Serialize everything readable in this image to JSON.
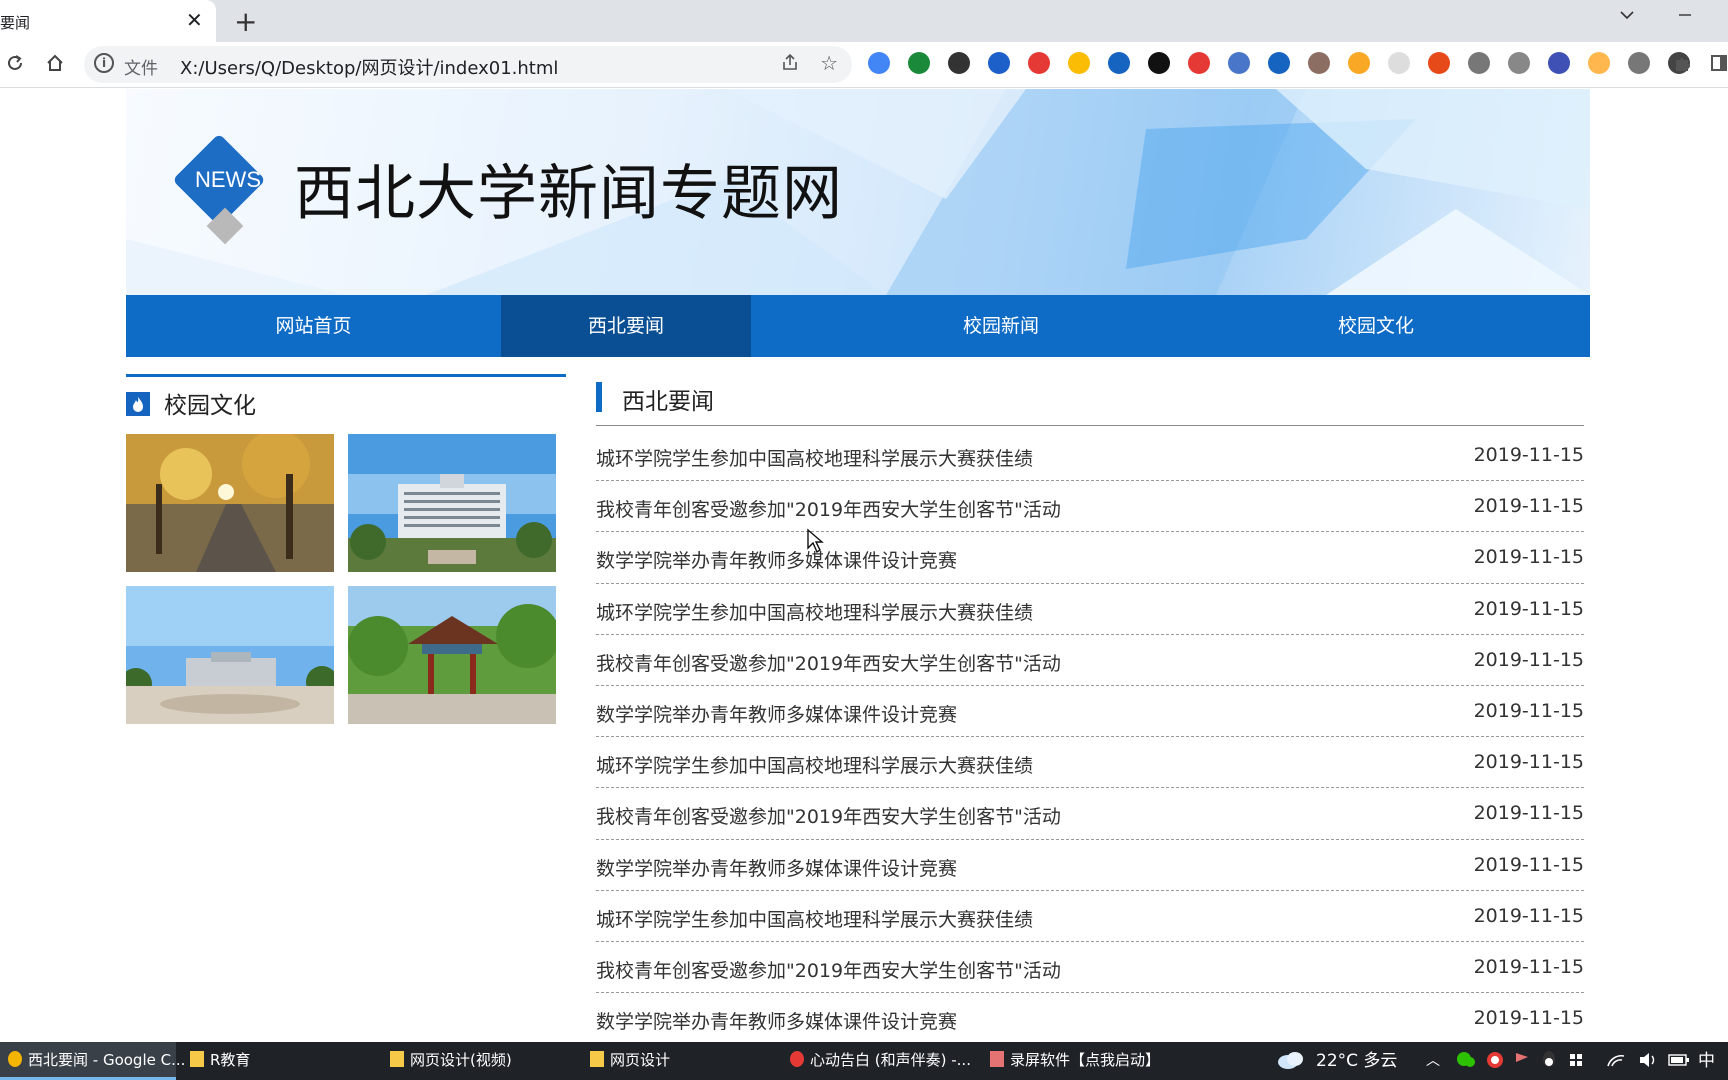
{
  "browser": {
    "tab_title": "要闻",
    "tab_close": "✕",
    "new_tab": "+",
    "url_prefix": "文件",
    "url": "X:/Users/Q/Desktop/网页设计/index01.html",
    "extension_colors": [
      "#4285f4",
      "#1a8a3a",
      "#333333",
      "#1e60c9",
      "#e53935",
      "#fbbc05",
      "#1565c0",
      "#111111",
      "#e53935",
      "#4a76c9",
      "#1565c0",
      "#8d6e63",
      "#f9a825",
      "#dddddd",
      "#e64a19",
      "#777777",
      "#888888",
      "#3f51b5",
      "#ffb74d",
      "#777777",
      "#444444"
    ]
  },
  "banner": {
    "logo_text": "NEWS",
    "site_title": "西北大学新闻专题网"
  },
  "nav": {
    "items": [
      "网站首页",
      "西北要闻",
      "校园新闻",
      "校园文化"
    ],
    "active_index": 1
  },
  "left": {
    "title": "校园文化",
    "icon": "flame-icon"
  },
  "right": {
    "title": "西北要闻",
    "news": [
      {
        "title": "城环学院学生参加中国高校地理科学展示大赛获佳绩",
        "date": "2019-11-15"
      },
      {
        "title": "我校青年创客受邀参加\"2019年西安大学生创客节\"活动",
        "date": "2019-11-15"
      },
      {
        "title": "数学学院举办青年教师多媒体课件设计竞赛",
        "date": "2019-11-15"
      },
      {
        "title": "城环学院学生参加中国高校地理科学展示大赛获佳绩",
        "date": "2019-11-15"
      },
      {
        "title": "我校青年创客受邀参加\"2019年西安大学生创客节\"活动",
        "date": "2019-11-15"
      },
      {
        "title": "数学学院举办青年教师多媒体课件设计竞赛",
        "date": "2019-11-15"
      },
      {
        "title": "城环学院学生参加中国高校地理科学展示大赛获佳绩",
        "date": "2019-11-15"
      },
      {
        "title": "我校青年创客受邀参加\"2019年西安大学生创客节\"活动",
        "date": "2019-11-15"
      },
      {
        "title": "数学学院举办青年教师多媒体课件设计竞赛",
        "date": "2019-11-15"
      },
      {
        "title": "城环学院学生参加中国高校地理科学展示大赛获佳绩",
        "date": "2019-11-15"
      },
      {
        "title": "我校青年创客受邀参加\"2019年西安大学生创客节\"活动",
        "date": "2019-11-15"
      },
      {
        "title": "数学学院举办青年教师多媒体课件设计竞赛",
        "date": "2019-11-15"
      }
    ]
  },
  "taskbar": {
    "tasks": [
      "西北要闻 - Google C...",
      "R教育",
      "网页设计(视频)",
      "网页设计",
      "心动告白 (和声伴奏) -...",
      "录屏软件【点我启动】"
    ],
    "weather": "22°C 多云",
    "ime": "中"
  }
}
